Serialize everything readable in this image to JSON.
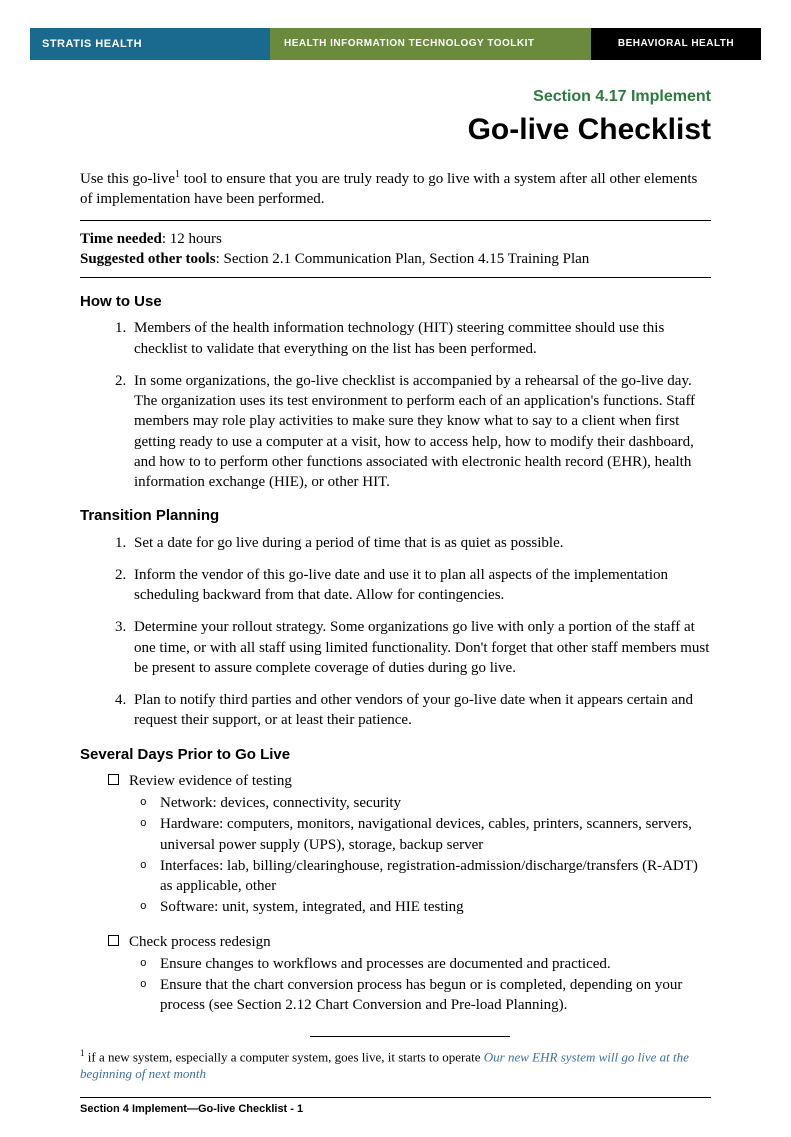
{
  "header": {
    "left": "STRATIS HEALTH",
    "mid": "HEALTH INFORMATION TECHNOLOGY TOOLKIT",
    "right": "BEHAVIORAL HEALTH"
  },
  "section_label": "Section 4.17 Implement",
  "title": "Go-live Checklist",
  "intro_pre": "Use this go-live",
  "intro_sup": "1",
  "intro_post": " tool to ensure that you are truly ready to go live with a system after all other elements of implementation have been performed.",
  "time_needed_label": "Time needed",
  "time_needed_value": ": 12 hours",
  "suggested_label": "Suggested other tools",
  "suggested_value": ": Section 2.1 Communication Plan, Section 4.15 Training Plan",
  "how_to_use_heading": "How to Use",
  "how_to_use": [
    "Members of the health information technology (HIT) steering committee should use this checklist to validate that everything on the list has been performed.",
    "In some organizations, the go-live checklist is accompanied by a rehearsal of the go-live day. The organization uses its test environment to perform each of an application's functions. Staff members may role play activities to make sure they know what to say to a client when first getting ready to use a computer at a visit, how to access help, how to modify their dashboard, and how to to perform other functions associated with electronic health record (EHR), health information exchange (HIE), or other HIT."
  ],
  "transition_heading": "Transition Planning",
  "transition": [
    "Set a date for go live during a period of time that is as quiet as possible.",
    "Inform the vendor of this go-live date and use it to plan all aspects of the implementation scheduling backward from that date. Allow for contingencies.",
    "Determine your rollout strategy. Some organizations go live with only a portion of the staff at one time, or with all staff using limited functionality. Don't forget that other staff members must be present to assure complete coverage of duties during go live.",
    "Plan to notify third parties and other vendors of your go-live date when it appears certain and request their support, or at least their patience."
  ],
  "prior_heading": "Several Days Prior to Go Live",
  "prior": [
    {
      "label": "Review evidence of testing",
      "items": [
        "Network: devices, connectivity, security",
        "Hardware: computers, monitors, navigational devices, cables, printers, scanners, servers, universal power supply (UPS), storage, backup server",
        "Interfaces: lab, billing/clearinghouse, registration-admission/discharge/transfers (R-ADT) as applicable, other",
        "Software: unit, system, integrated, and HIE testing"
      ]
    },
    {
      "label": "Check process redesign",
      "items": [
        "Ensure changes to workflows and processes are documented and practiced.",
        "Ensure that the chart conversion process has begun or is completed, depending on your process (see Section 2.12 Chart Conversion and Pre-load Planning)."
      ]
    }
  ],
  "footnote_sup": "1",
  "footnote_text": " if a new system, especially a computer system, goes live, it starts to operate ",
  "footnote_example": "Our new EHR system will go live at the beginning of next month",
  "footer": "Section 4 Implement—Go-live Checklist - 1"
}
